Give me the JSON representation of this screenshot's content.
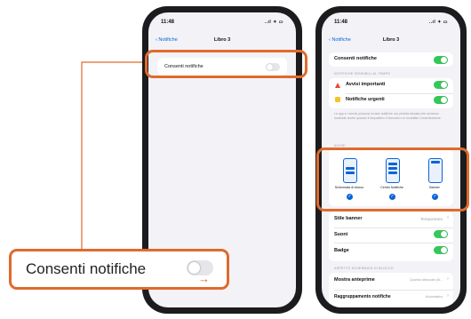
{
  "status_bar": {
    "time": "11:48",
    "signal": "..ıl ✦ ▭"
  },
  "nav": {
    "back_label": "Notifiche",
    "title": "Libro 3"
  },
  "phone_left": {
    "row_label": "Consenti notifiche",
    "toggle_on": false
  },
  "phone_right": {
    "allow_label": "Consenti notifiche",
    "section_interruptions": "NOTIFICHE SENSIBILI AL TEMPO",
    "important_label": "Avvisi importanti",
    "urgent_label": "Notifiche urgenti",
    "description": "Le app e i servizi possono inviare notifiche con priorità elevata che verranno mostrate anche quando il dispositivo è bloccato o in modalità Concentrazione.",
    "section_alerts": "AVVISI",
    "alert_styles": [
      "Schermata di blocco",
      "Centro Notifiche",
      "Banner"
    ],
    "banner_style_label": "Stile banner",
    "banner_style_value": "Temporaneo",
    "sounds_label": "Suoni",
    "badges_label": "Badge",
    "section_lock": "ASPETTO SCHERMATA DI BLOCCO",
    "preview_label": "Mostra anteprime",
    "preview_value": "Quando sbloccato (di...",
    "grouping_label": "Raggruppamento notifiche",
    "grouping_value": "Automatico"
  },
  "callout": {
    "label": "Consenti notifiche",
    "arrow": "→"
  },
  "colors": {
    "accent": "#e06a2c",
    "toggle_on": "#34c759",
    "link": "#0a64d8",
    "icon_red": "#f1452f",
    "icon_yellow": "#f6c324"
  }
}
